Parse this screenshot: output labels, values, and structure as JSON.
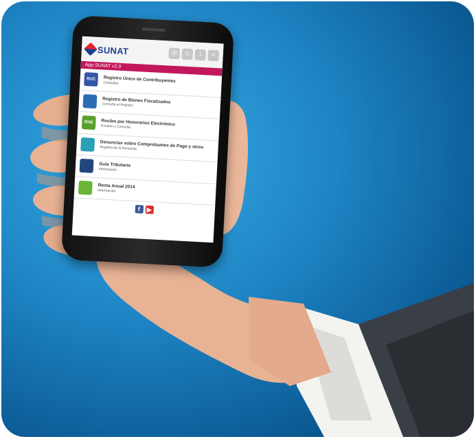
{
  "header": {
    "brand": "SUNAT"
  },
  "app_bar": {
    "title": "App SUNAT v2.0"
  },
  "menu": [
    {
      "title": "Registro Único de Contribuyentes",
      "subtitle": "Consultas",
      "icon": "ruc-icon",
      "icon_text": "RUC",
      "color": "#3455a8"
    },
    {
      "title": "Registro de Bienes Fiscalizados",
      "subtitle": "Consulta al Registro",
      "icon": "bienes-icon",
      "icon_text": "",
      "color": "#2b6cb3"
    },
    {
      "title": "Recibo por Honorarios Electrónico",
      "subtitle": "Emisión y Consulta",
      "icon": "rhe-icon",
      "icon_text": "RHE",
      "color": "#5aa02c"
    },
    {
      "title": "Denuncias sobre Comprobantes de Pago y otros",
      "subtitle": "Registro de la Denuncia",
      "icon": "denuncias-icon",
      "icon_text": "",
      "color": "#2a9fb8"
    },
    {
      "title": "Guía Tributaria",
      "subtitle": "Información",
      "icon": "guia-icon",
      "icon_text": "",
      "color": "#24467f"
    },
    {
      "title": "Renta Anual 2014",
      "subtitle": "Información",
      "icon": "renta-icon",
      "icon_text": "",
      "color": "#6bb536"
    }
  ],
  "colors": {
    "accent_bar": "#c2185b",
    "background": "#1f86c6"
  }
}
